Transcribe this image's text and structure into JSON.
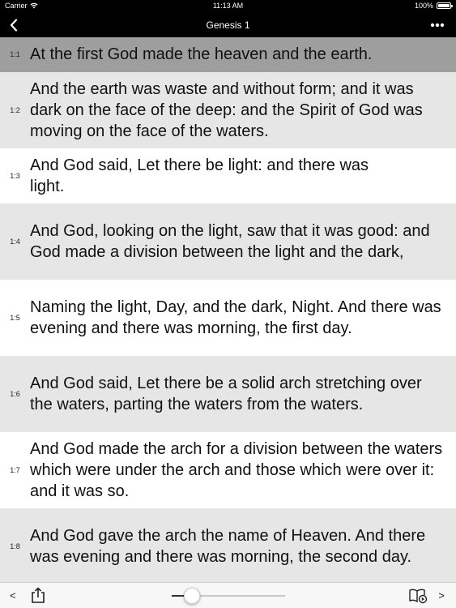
{
  "status_bar": {
    "carrier": "Carrier",
    "time": "11:13 AM",
    "battery": "100%"
  },
  "nav": {
    "title": "Genesis 1",
    "back_icon": "chevron-left-icon",
    "more_icon": "more-horizontal-icon"
  },
  "verses": [
    {
      "ref": "1:1",
      "text": "At the first God made the heaven and the earth."
    },
    {
      "ref": "1:2",
      "text": "And the earth was waste and without form; and it was dark on the face of the deep: and the Spirit of God was moving on the face of the waters."
    },
    {
      "ref": "1:3",
      "text": "And God said, Let there be light: and there was light."
    },
    {
      "ref": "1:4",
      "text": "And God, looking on the light, saw that it was good: and God made a division between the light and the dark,"
    },
    {
      "ref": "1:5",
      "text": "Naming the light, Day, and the dark, Night. And there was evening and there was morning, the first day."
    },
    {
      "ref": "1:6",
      "text": "And God said, Let there be a solid arch stretching over the waters, parting the waters from the waters."
    },
    {
      "ref": "1:7",
      "text": "And God made the arch for a division between the waters which were under the arch and those which were over it: and it was so."
    },
    {
      "ref": "1:8",
      "text": "And God gave the arch the name of Heaven. And there was evening and there was morning, the second day."
    }
  ],
  "toolbar": {
    "prev_label": "<",
    "next_label": ">",
    "share_icon": "share-icon",
    "audio_icon": "book-audio-icon",
    "slider_value": 0.18
  }
}
